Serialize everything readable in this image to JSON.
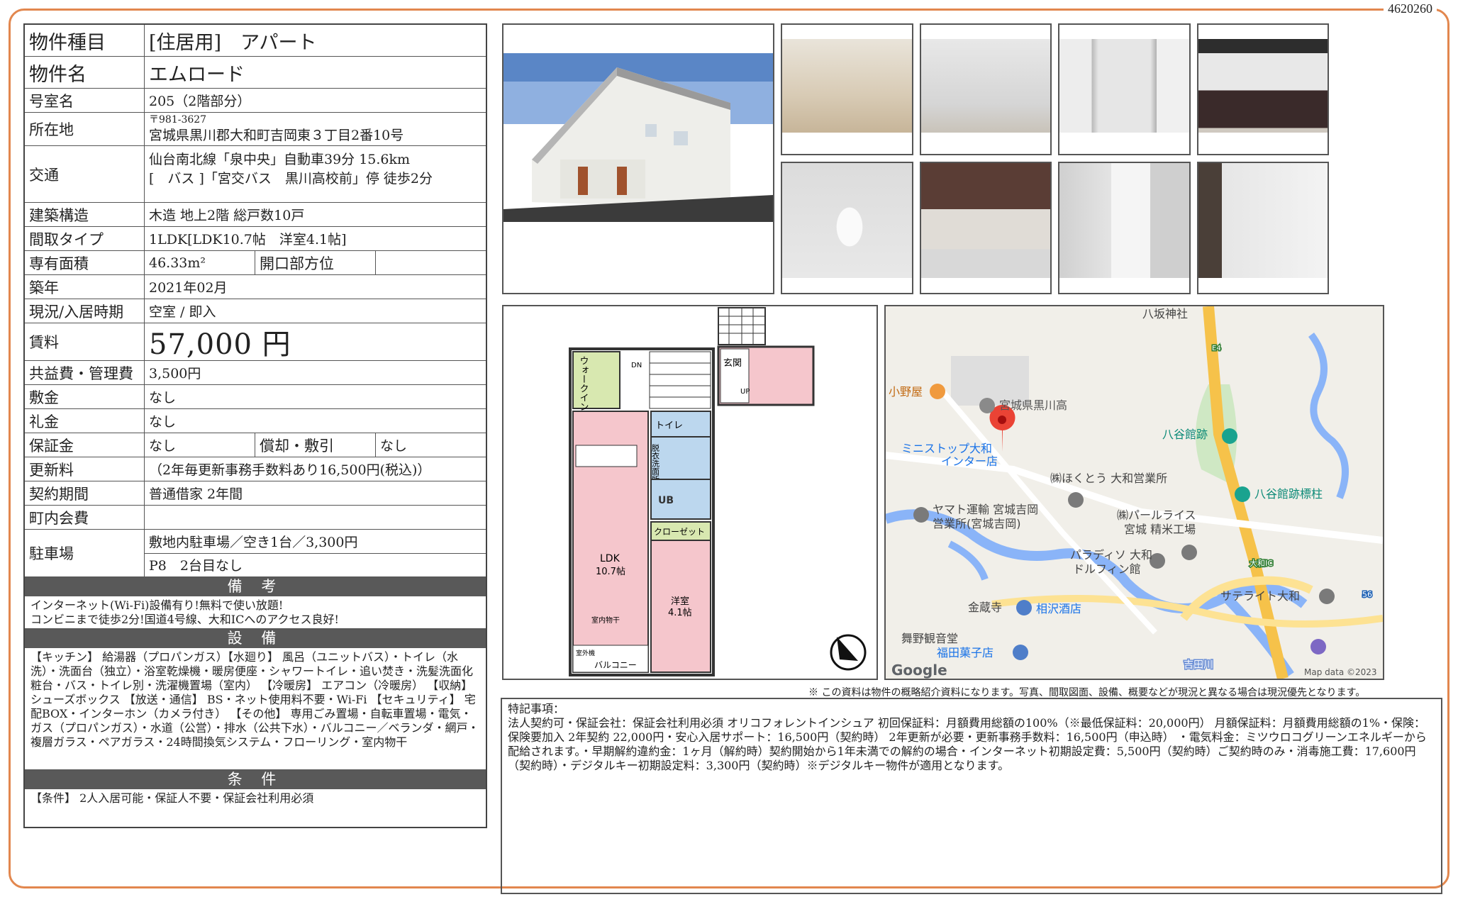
{
  "doc_id": "4620260",
  "property": {
    "type_label": "物件種目",
    "type_value": "[住居用]　アパート",
    "name_label": "物件名",
    "name_value": "エムロード",
    "room_label": "号室名",
    "room_value": "205（2階部分）",
    "address_label": "所在地",
    "postal": "〒981-3627",
    "address": "宮城県黒川郡大和町吉岡東３丁目2番10号",
    "transport_label": "交通",
    "transport_1": "仙台南北線「泉中央」自動車39分 15.6km",
    "transport_2": "[　バス ]「宮交バス　黒川高校前」停 徒歩2分",
    "structure_label": "建築構造",
    "structure_value": "木造 地上2階 総戸数10戸",
    "layout_label": "間取タイプ",
    "layout_value": "1LDK[LDK10.7帖　洋室4.1帖]",
    "area_label": "専有面積",
    "area_value": "46.33m²",
    "opening_label": "開口部方位",
    "opening_value": "",
    "built_label": "築年",
    "built_value": "2021年02月",
    "status_label": "現況/入居時期",
    "status_value": "空室 / 即入",
    "rent_label": "賃料",
    "rent_value": "57,000 円",
    "fee_label": "共益費・管理費",
    "fee_value": "3,500円",
    "deposit_label": "敷金",
    "deposit_value": "なし",
    "key_label": "礼金",
    "key_value": "なし",
    "guarantee_label": "保証金",
    "guarantee_value": "なし",
    "amort_label": "償却・敷引",
    "amort_value": "なし",
    "renewal_label": "更新料",
    "renewal_value": "（2年毎更新事務手数料あり16,500円(税込)）",
    "contract_label": "契約期間",
    "contract_value": "普通借家 2年間",
    "assoc_label": "町内会費",
    "assoc_value": "",
    "parking_label": "駐車場",
    "parking_1": "敷地内駐車場／空き1台／3,300円",
    "parking_2": "P8　2台目なし"
  },
  "sections": {
    "remarks_title": "備 考",
    "remarks_1": "インターネット(Wi-Fi)設備有り!無料で使い放題!",
    "remarks_2": "コンビニまで徒歩2分!国道4号線、大和ICへのアクセス良好!",
    "equip_title": "設 備",
    "equip_text": "【キッチン】 給湯器（プロパンガス）【水廻り】 風呂（ユニットバス）・トイレ（水洗）・洗面台（独立）・浴室乾燥機・暖房便座・シャワートイレ・追い焚き・洗髪洗面化粧台・バス・トイレ別・洗濯機置場（室内） 【冷暖房】 エアコン（冷暖房） 【収納】 シューズボックス 【放送・通信】 BS・ネット使用料不要・Wi-Fi 【セキュリティ】 宅配BOX・インターホン（カメラ付き） 【その他】 専用ごみ置場・自転車置場・電気・ガス（プロパンガス）・水道（公営）・排水（公共下水）・バルコニー／ベランダ・網戸・複層ガラス・ペアガラス・24時間換気システム・フローリング・室内物干",
    "cond_title": "条 件",
    "cond_text": "【条件】 2人入居可能・保証人不要・保証会社利用必須"
  },
  "floorplan": {
    "walkin": "ウォークインクローゼット",
    "dn": "DN",
    "entrance": "玄関",
    "up": "UP",
    "toilet": "トイレ",
    "washroom": "脱衣洗面所",
    "ub": "UB",
    "closet": "クローゼット",
    "ldk": "LDK",
    "ldk_size": "10.7帖",
    "western": "洋室",
    "western_size": "4.1帖",
    "drying": "室内物干",
    "balcony": "バルコニー",
    "outdoor": "室外機"
  },
  "map": {
    "labels": [
      "八坂神社",
      "宮城県黒川高",
      "小野屋",
      "ミニストップ大和",
      "インター店",
      "八谷館跡",
      "㈱ほくとう 大和営業所",
      "八谷館跡標柱",
      "ヤマト運輸 宮城吉岡",
      "営業所(宮城吉岡)",
      "㈱パールライス",
      "宮城 精米工場",
      "パラディソ 大和",
      "ドルフィン館",
      "金蔵寺",
      "相沢酒店",
      "サテライト大和",
      "舞野観音堂",
      "福田菓子店",
      "大和IC",
      "吉田川",
      "E4",
      "56"
    ],
    "google": "Google",
    "attribution": "Map data ©2023"
  },
  "disclaimer": "※ この資料は物件の概略紹介資料になります。写真、間取図面、設備、概要などが現況と異なる場合は現況優先となります。",
  "notes": {
    "title": "特記事項：",
    "text": "法人契約可・保証会社：保証会社利用必須 オリコフォレントインシュア 初回保証料：月額費用総額の100%（※最低保証料：20,000円） 月額保証料：月額費用総額の1%・保険：保険要加入 2年契約 22,000円・安心入居サポート：16,500円（契約時） 2年更新が必要・更新事務手数料：16,500円（申込時） ・電気料金：ミツウロコグリーンエネルギーから配給されます。・早期解約違約金：1ヶ月（解約時）契約開始から1年未満での解約の場合・インターネット初期設定費：5,500円（契約時）ご契約時のみ・消毒施工費：17,600円（契約時）・デジタルキー初期設定料：3,300円（契約時）※デジタルキー物件が適用となります。"
  },
  "colors": {
    "frame": "#e2874e",
    "section_bar": "#595959",
    "floor_pink": "#f5c6cc",
    "floor_green": "#d8e8b0",
    "floor_blue": "#bcd7ee"
  }
}
